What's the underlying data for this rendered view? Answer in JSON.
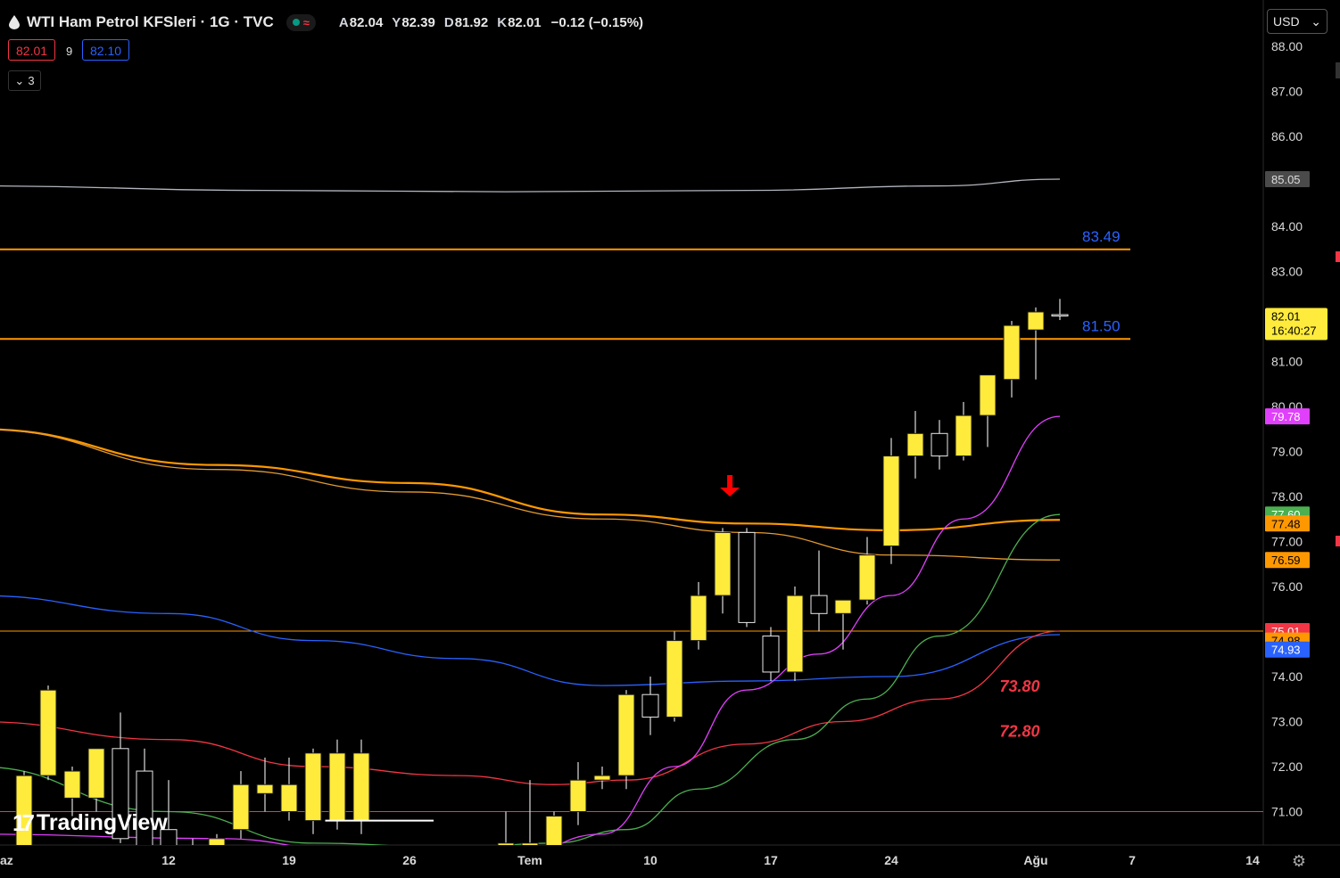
{
  "header": {
    "title": "WTI Ham Petrol KFSleri · 1G · TVC",
    "ohlc": [
      {
        "k": "A",
        "v": "82.04"
      },
      {
        "k": "Y",
        "v": "82.39"
      },
      {
        "k": "D",
        "v": "81.92"
      },
      {
        "k": "K",
        "v": "82.01"
      },
      {
        "k": "",
        "v": "−0.12 (−0.15%)"
      }
    ],
    "bid": "82.01",
    "spread": "9",
    "ask": "82.10",
    "indicators_count": "3",
    "currency": "USD",
    "logo_text": "TradingView"
  },
  "chart_data": {
    "type": "candlestick",
    "price_axis": {
      "range": [
        70.2,
        88.4
      ],
      "ticks": [
        "88.00",
        "87.00",
        "86.00",
        "85.00",
        "84.00",
        "83.00",
        "82.00",
        "81.00",
        "80.00",
        "79.00",
        "78.00",
        "77.00",
        "76.00",
        "75.00",
        "74.00",
        "73.00",
        "72.00",
        "71.00"
      ]
    },
    "time_axis": {
      "labels": [
        {
          "label": "az",
          "slot": -1
        },
        {
          "label": "12",
          "slot": 6
        },
        {
          "label": "19",
          "slot": 11
        },
        {
          "label": "26",
          "slot": 16
        },
        {
          "label": "Tem",
          "slot": 21
        },
        {
          "label": "10",
          "slot": 26
        },
        {
          "label": "17",
          "slot": 31
        },
        {
          "label": "24",
          "slot": 36
        },
        {
          "label": "Ağu",
          "slot": 42
        },
        {
          "label": "7",
          "slot": 46
        },
        {
          "label": "14",
          "slot": 51
        }
      ]
    },
    "candles": [
      {
        "slot": 0,
        "o": 70.2,
        "h": 71.9,
        "l": 70.0,
        "c": 71.8
      },
      {
        "slot": 1,
        "o": 71.8,
        "h": 73.8,
        "l": 71.7,
        "c": 73.7
      },
      {
        "slot": 2,
        "o": 71.3,
        "h": 72.0,
        "l": 70.9,
        "c": 71.9
      },
      {
        "slot": 3,
        "o": 71.3,
        "h": 72.4,
        "l": 71.0,
        "c": 72.4
      },
      {
        "slot": 4,
        "o": 72.4,
        "h": 73.2,
        "l": 70.3,
        "c": 70.4
      },
      {
        "slot": 5,
        "o": 71.9,
        "h": 72.4,
        "l": 70.0,
        "c": 70.1
      },
      {
        "slot": 6,
        "o": 70.6,
        "h": 71.7,
        "l": 70.0,
        "c": 70.0
      },
      {
        "slot": 7,
        "o": 70.2,
        "h": 70.4,
        "l": 70.0,
        "c": 70.0
      },
      {
        "slot": 8,
        "o": 70.2,
        "h": 70.5,
        "l": 69.8,
        "c": 70.4
      },
      {
        "slot": 9,
        "o": 70.6,
        "h": 71.9,
        "l": 70.4,
        "c": 71.6
      },
      {
        "slot": 10,
        "o": 71.4,
        "h": 72.2,
        "l": 71.0,
        "c": 71.6
      },
      {
        "slot": 11,
        "o": 71.0,
        "h": 72.2,
        "l": 70.8,
        "c": 71.6
      },
      {
        "slot": 12,
        "o": 70.8,
        "h": 72.4,
        "l": 70.5,
        "c": 72.3
      },
      {
        "slot": 13,
        "o": 70.8,
        "h": 72.6,
        "l": 70.6,
        "c": 72.3
      },
      {
        "slot": 14,
        "o": 70.8,
        "h": 72.6,
        "l": 70.5,
        "c": 72.3
      },
      {
        "slot": 20,
        "o": 70.1,
        "h": 71.0,
        "l": 69.9,
        "c": 70.3
      },
      {
        "slot": 21,
        "o": 70.1,
        "h": 71.7,
        "l": 69.8,
        "c": 70.3
      },
      {
        "slot": 22,
        "o": 70.2,
        "h": 71.0,
        "l": 70.0,
        "c": 70.9
      },
      {
        "slot": 23,
        "o": 71.0,
        "h": 72.1,
        "l": 70.7,
        "c": 71.7
      },
      {
        "slot": 24,
        "o": 71.7,
        "h": 72.0,
        "l": 71.5,
        "c": 71.8
      },
      {
        "slot": 25,
        "o": 71.8,
        "h": 73.7,
        "l": 71.5,
        "c": 73.6
      },
      {
        "slot": 26,
        "o": 73.6,
        "h": 74.0,
        "l": 72.7,
        "c": 73.1
      },
      {
        "slot": 27,
        "o": 73.1,
        "h": 75.0,
        "l": 73.0,
        "c": 74.8
      },
      {
        "slot": 28,
        "o": 74.8,
        "h": 76.1,
        "l": 74.6,
        "c": 75.8
      },
      {
        "slot": 29,
        "o": 75.8,
        "h": 77.3,
        "l": 75.4,
        "c": 77.2
      },
      {
        "slot": 30,
        "o": 77.2,
        "h": 77.3,
        "l": 75.1,
        "c": 75.2
      },
      {
        "slot": 31,
        "o": 74.9,
        "h": 75.1,
        "l": 73.9,
        "c": 74.1
      },
      {
        "slot": 32,
        "o": 74.1,
        "h": 76.0,
        "l": 73.9,
        "c": 75.8
      },
      {
        "slot": 33,
        "o": 75.8,
        "h": 76.8,
        "l": 75.0,
        "c": 75.4
      },
      {
        "slot": 34,
        "o": 75.4,
        "h": 75.7,
        "l": 74.6,
        "c": 75.7
      },
      {
        "slot": 35,
        "o": 75.7,
        "h": 77.1,
        "l": 75.6,
        "c": 76.7
      },
      {
        "slot": 36,
        "o": 76.9,
        "h": 79.3,
        "l": 76.5,
        "c": 78.9
      },
      {
        "slot": 37,
        "o": 78.9,
        "h": 79.9,
        "l": 78.4,
        "c": 79.4
      },
      {
        "slot": 38,
        "o": 79.4,
        "h": 79.7,
        "l": 78.6,
        "c": 78.9
      },
      {
        "slot": 39,
        "o": 78.9,
        "h": 80.1,
        "l": 78.8,
        "c": 79.8
      },
      {
        "slot": 40,
        "o": 79.8,
        "h": 80.7,
        "l": 79.1,
        "c": 80.7
      },
      {
        "slot": 41,
        "o": 80.6,
        "h": 81.9,
        "l": 80.2,
        "c": 81.8
      },
      {
        "slot": 42,
        "o": 81.7,
        "h": 82.2,
        "l": 80.6,
        "c": 82.1
      },
      {
        "slot": 43,
        "o": 82.04,
        "h": 82.39,
        "l": 81.92,
        "c": 82.01
      }
    ],
    "moving_averages": [
      {
        "color": "#b2b5be",
        "label": "85.05",
        "points": [
          [
            -2,
            84.9
          ],
          [
            10,
            84.8
          ],
          [
            20,
            84.77
          ],
          [
            30,
            84.8
          ],
          [
            38,
            84.9
          ],
          [
            43,
            85.05
          ]
        ]
      },
      {
        "color": "#ff9800",
        "label": "77.48",
        "points": [
          [
            -2,
            79.5
          ],
          [
            8,
            78.7
          ],
          [
            16,
            78.3
          ],
          [
            24,
            77.6
          ],
          [
            30,
            77.4
          ],
          [
            36,
            77.25
          ],
          [
            43,
            77.48
          ]
        ]
      },
      {
        "color": "#e39a30",
        "label": "76.59",
        "points": [
          [
            -2,
            79.5
          ],
          [
            8,
            78.6
          ],
          [
            16,
            78.1
          ],
          [
            24,
            77.5
          ],
          [
            30,
            77.2
          ],
          [
            36,
            76.7
          ],
          [
            43,
            76.59
          ]
        ]
      },
      {
        "color": "#2962ff",
        "label": "74.93",
        "points": [
          [
            -2,
            75.8
          ],
          [
            6,
            75.4
          ],
          [
            12,
            74.8
          ],
          [
            18,
            74.4
          ],
          [
            24,
            73.8
          ],
          [
            30,
            73.9
          ],
          [
            36,
            74.0
          ],
          [
            43,
            74.93
          ]
        ]
      },
      {
        "color": "#f23645",
        "label": "",
        "points": [
          [
            -2,
            73.0
          ],
          [
            6,
            72.6
          ],
          [
            12,
            72.0
          ],
          [
            18,
            71.8
          ],
          [
            22,
            71.6
          ],
          [
            25,
            71.7
          ],
          [
            30,
            72.5
          ],
          [
            34,
            73.0
          ],
          [
            38,
            73.5
          ],
          [
            43,
            75.01
          ]
        ]
      },
      {
        "color": "#4caf50",
        "label": "77.60",
        "points": [
          [
            -2,
            72.0
          ],
          [
            6,
            71.0
          ],
          [
            12,
            70.3
          ],
          [
            18,
            70.2
          ],
          [
            22,
            70.3
          ],
          [
            25,
            70.6
          ],
          [
            28,
            71.5
          ],
          [
            32,
            72.6
          ],
          [
            35,
            73.5
          ],
          [
            38,
            74.9
          ],
          [
            43,
            77.6
          ]
        ]
      },
      {
        "color": "#e040fb",
        "label": "79.78",
        "points": [
          [
            -2,
            70.5
          ],
          [
            8,
            70.4
          ],
          [
            14,
            70.1
          ],
          [
            20,
            69.9
          ],
          [
            24,
            70.5
          ],
          [
            27,
            72.0
          ],
          [
            30,
            73.7
          ],
          [
            33,
            74.5
          ],
          [
            36,
            75.8
          ],
          [
            39,
            77.5
          ],
          [
            43,
            79.78
          ]
        ]
      }
    ],
    "horizontal_lines": [
      {
        "price": 83.49,
        "color": "#ff9800",
        "label": "83.49",
        "label_color": "#2962ff"
      },
      {
        "price": 81.5,
        "color": "#ff9800",
        "label": "81.50",
        "label_color": "#2962ff"
      },
      {
        "price": 75.01,
        "color": "#ff9800",
        "label": "",
        "label_color": ""
      },
      {
        "price": 71.0,
        "color": "#f23645",
        "label": "",
        "label_color": ""
      }
    ],
    "annotations": [
      {
        "text": "73.80",
        "price": 73.8,
        "slot": 40.5,
        "color": "#f23645"
      },
      {
        "text": "72.80",
        "price": 72.8,
        "slot": 40.5,
        "color": "#f23645"
      }
    ],
    "arrow": {
      "slot": 29.3,
      "price": 78.0,
      "color": "#ff0000"
    },
    "axis_labels": [
      {
        "text": "85.05",
        "price": 85.05,
        "bg": "#4a4a4a",
        "fg": "#dddddd"
      },
      {
        "text": "79.78",
        "price": 79.78,
        "bg": "#e040fb",
        "fg": "#ffffff"
      },
      {
        "text": "77.60",
        "price": 77.6,
        "bg": "#4caf50",
        "fg": "#ffffff"
      },
      {
        "text": "77.48",
        "price": 77.4,
        "bg": "#ff9800",
        "fg": "#000000"
      },
      {
        "text": "76.59",
        "price": 76.59,
        "bg": "#ff9800",
        "fg": "#000000"
      },
      {
        "text": "75.01",
        "price": 75.01,
        "bg": "#f23645",
        "fg": "#ffffff"
      },
      {
        "text": "74.98",
        "price": 74.8,
        "bg": "#ff9800",
        "fg": "#000000"
      },
      {
        "text": "74.93",
        "price": 74.6,
        "bg": "#2962ff",
        "fg": "#ffffff"
      }
    ],
    "last_price": {
      "price": "82.01",
      "countdown": "16:40:27",
      "value": 82.01
    },
    "colors": {
      "up": "#ffeb3b",
      "down": "#000000",
      "wick": "#dddddd",
      "background": "#000000"
    }
  }
}
